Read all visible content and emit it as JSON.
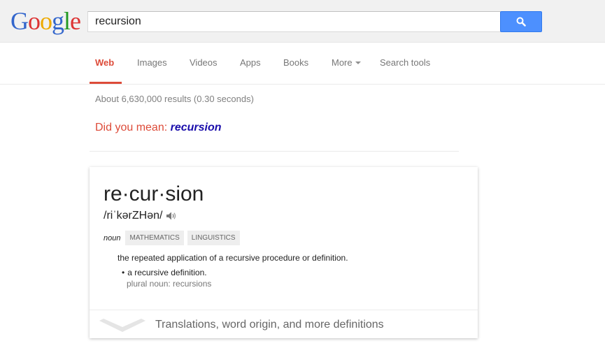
{
  "header": {
    "logo": [
      "G",
      "o",
      "o",
      "g",
      "l",
      "e"
    ],
    "logo_colors": [
      "#3366cc",
      "#dd3333",
      "#eeaa00",
      "#3366cc",
      "#229922",
      "#dd3333"
    ],
    "search_value": "recursion"
  },
  "nav": {
    "items": [
      "Web",
      "Images",
      "Videos",
      "Apps",
      "Books",
      "More",
      "Search tools"
    ],
    "active": "Web"
  },
  "results": {
    "stats": "About 6,630,000 results (0.30 seconds)",
    "did_you_mean_label": "Did you mean: ",
    "did_you_mean_term": "recursion"
  },
  "dictionary": {
    "word": "re·cur·sion",
    "phonetic": "/riˈkərZHən/",
    "part_of_speech": "noun",
    "tags": [
      "MATHEMATICS",
      "LINGUISTICS"
    ],
    "definition": "the repeated application of a recursive procedure or definition.",
    "example_bullet": "•",
    "example": "a recursive definition.",
    "plural": "plural noun: recursions",
    "more_link": "Translations, word origin, and more definitions"
  },
  "colors": {
    "accent_red": "#dd4b39",
    "link_blue": "#1a0dab",
    "search_button": "#4d90fe"
  },
  "icons": {
    "search": "search-icon",
    "speaker": "speaker-icon",
    "chevron": "chevron-down-icon"
  }
}
